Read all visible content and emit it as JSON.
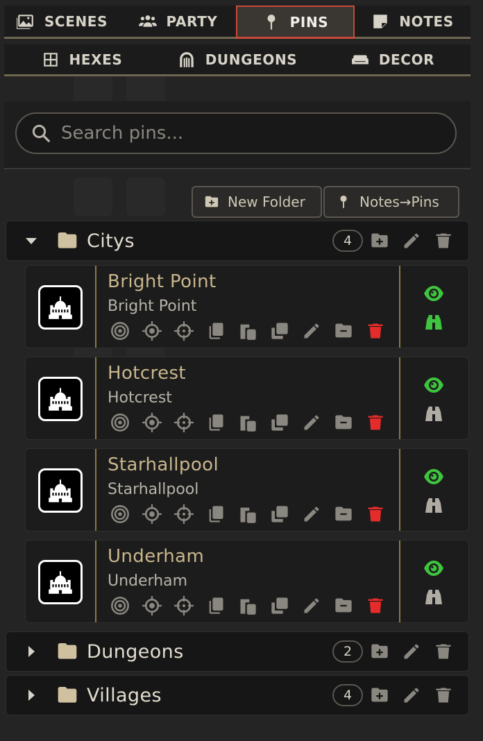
{
  "tabs_primary": [
    {
      "label": "SCENES",
      "icon": "image-icon"
    },
    {
      "label": "PARTY",
      "icon": "users-icon"
    },
    {
      "label": "PINS",
      "icon": "map-pin-icon",
      "active": true
    },
    {
      "label": "NOTES",
      "icon": "sticky-note-icon"
    }
  ],
  "tabs_secondary": [
    {
      "label": "HEXES",
      "icon": "grid-icon"
    },
    {
      "label": "DUNGEONS",
      "icon": "dungeon-icon"
    },
    {
      "label": "DECOR",
      "icon": "couch-icon"
    }
  ],
  "search": {
    "placeholder": "Search pins..."
  },
  "actions": {
    "new_folder": "New Folder",
    "notes_to_pins": "Notes→Pins"
  },
  "folders": [
    {
      "name": "Citys",
      "count": "4",
      "expanded": true,
      "pins": [
        {
          "title": "Bright Point",
          "subtitle": "Bright Point",
          "visible": true,
          "revealed": true
        },
        {
          "title": "Hotcrest",
          "subtitle": "Hotcrest",
          "visible": true,
          "revealed": false
        },
        {
          "title": "Starhallpool",
          "subtitle": "Starhallpool",
          "visible": true,
          "revealed": false
        },
        {
          "title": "Underham",
          "subtitle": "Underham",
          "visible": true,
          "revealed": false
        }
      ]
    },
    {
      "name": "Dungeons",
      "count": "2",
      "expanded": false
    },
    {
      "name": "Villages",
      "count": "4",
      "expanded": false
    }
  ],
  "colors": {
    "accent": "#c84a3a",
    "gold": "#8a7a45",
    "green": "#3ec43e",
    "red": "#e62b2b",
    "text_title": "#c9b78d"
  }
}
